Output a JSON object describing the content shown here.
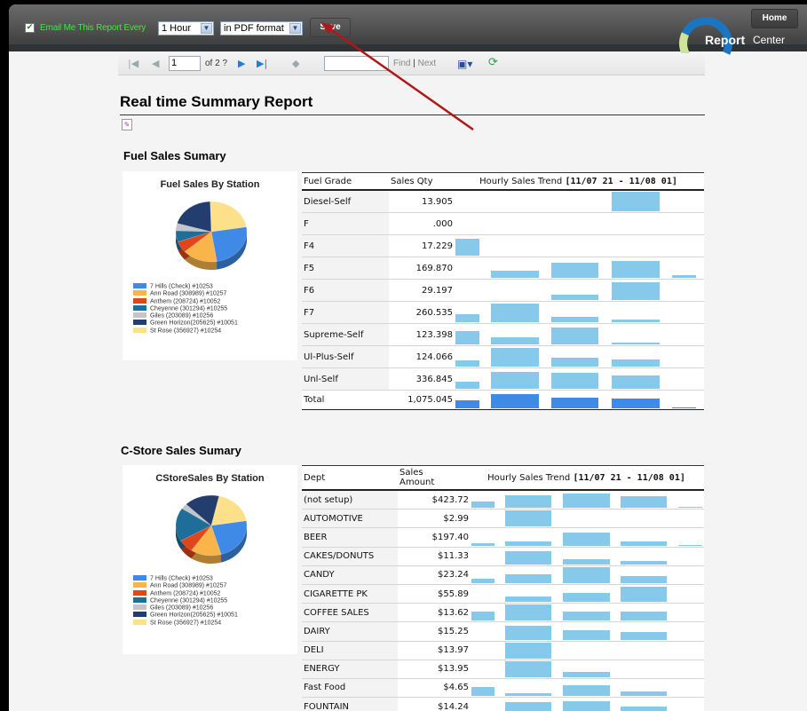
{
  "top_bar": {
    "email_checkbox_checked": true,
    "email_label": "Email Me This Report Every",
    "interval_select": "1 Hour",
    "format_select": "in PDF format",
    "save_label": "Save",
    "home_label": "Home",
    "logo_report": "Report",
    "logo_center": "Center",
    "accent_green": "#3ee83e"
  },
  "viewer_toolbar": {
    "page_value": "1",
    "page_of": "of 2 ?",
    "find_value": "",
    "find_label": "Find",
    "separator": "|",
    "next_label": "Next",
    "icons": [
      "first-page-icon",
      "previous-page-icon",
      "next-page-icon",
      "last-page-icon",
      "back-icon",
      "export-icon",
      "refresh-icon"
    ]
  },
  "report": {
    "title": "Real time Summary Report",
    "fuel": {
      "section_title": "Fuel Sales Sumary",
      "chart": {
        "title": "Fuel Sales By Station",
        "legend": [
          {
            "label": "7 Hills (Check) #10253",
            "color": "#3f8ae6"
          },
          {
            "label": "Ann Road (308989) #10257",
            "color": "#f9b44a"
          },
          {
            "label": "Anthem (208724) #10052",
            "color": "#e1461b"
          },
          {
            "label": "Cheyenne (301294) #10255",
            "color": "#1e6e99"
          },
          {
            "label": "Giles (203089) #10256",
            "color": "#c2c5c9"
          },
          {
            "label": "Green Horizon(205625) #10051",
            "color": "#233d6e"
          },
          {
            "label": "St Rose (356927) #10254",
            "color": "#fde08a"
          }
        ],
        "slices": [
          0.25,
          0.16,
          0.06,
          0.06,
          0.04,
          0.2,
          0.23
        ]
      },
      "table": {
        "headers": {
          "col1": "Fuel Grade",
          "col2": "Sales Qty",
          "col3": "Hourly Sales Trend",
          "range": "[11/07 21 - 11/08 01]"
        },
        "rows": [
          {
            "name": "Diesel-Self",
            "value": "13.905",
            "trend": [
              0,
              0,
              0,
              1.0,
              0
            ]
          },
          {
            "name": "F",
            "value": ".000",
            "trend": [
              0,
              0,
              0,
              0,
              0
            ]
          },
          {
            "name": "F4",
            "value": "17.229",
            "trend": [
              0.85,
              0,
              0,
              0,
              0
            ]
          },
          {
            "name": "F5",
            "value": "169.870",
            "trend": [
              0,
              0.35,
              0.75,
              0.85,
              0.15
            ]
          },
          {
            "name": "F6",
            "value": "29.197",
            "trend": [
              0,
              0,
              0.25,
              0.9,
              0
            ]
          },
          {
            "name": "F7",
            "value": "260.535",
            "trend": [
              0.4,
              0.95,
              0.25,
              0.15,
              0
            ]
          },
          {
            "name": "Supreme-Self",
            "value": "123.398",
            "trend": [
              0.7,
              0.35,
              0.85,
              0.1,
              0
            ]
          },
          {
            "name": "Ul-Plus-Self",
            "value": "124.066",
            "trend": [
              0.3,
              0.95,
              0.45,
              0.35,
              0
            ]
          },
          {
            "name": "Unl-Self",
            "value": "336.845",
            "trend": [
              0.35,
              0.85,
              0.8,
              0.7,
              0
            ]
          }
        ],
        "total": {
          "name": "Total",
          "value": "1,075.045",
          "trend": [
            0.45,
            0.85,
            0.65,
            0.6,
            0.06
          ]
        }
      }
    },
    "cstore": {
      "section_title": "C-Store Sales Sumary",
      "chart": {
        "title": "CStoreSales By Station",
        "legend": [
          {
            "label": "7 Hills (Check) #10253",
            "color": "#3f8ae6"
          },
          {
            "label": "Ann Road (308989) #10257",
            "color": "#f9b44a"
          },
          {
            "label": "Anthem (208724) #10052",
            "color": "#e1461b"
          },
          {
            "label": "Cheyenne (301294) #10255",
            "color": "#1e6e99"
          },
          {
            "label": "Giles (203089) #10256",
            "color": "#c2c5c9"
          },
          {
            "label": "Green Horizon(205625) #10051",
            "color": "#233d6e"
          },
          {
            "label": "St Rose (356927) #10254",
            "color": "#fde08a"
          }
        ],
        "slices": [
          0.23,
          0.14,
          0.07,
          0.18,
          0.03,
          0.16,
          0.19
        ]
      },
      "table": {
        "headers": {
          "col1": "Dept",
          "col2a": "Sales",
          "col2b": "Amount",
          "col3": "Hourly Sales Trend",
          "range": "[11/07 21 - 11/08 01]"
        },
        "rows": [
          {
            "name": "(not setup)",
            "value": "$423.72",
            "trend": [
              0.4,
              0.75,
              0.9,
              0.7,
              0.05
            ]
          },
          {
            "name": "AUTOMOTIVE",
            "value": "$2.99",
            "trend": [
              0,
              1.0,
              0,
              0,
              0
            ]
          },
          {
            "name": "BEER",
            "value": "$197.40",
            "trend": [
              0.15,
              0.25,
              0.85,
              0.3,
              0.05
            ]
          },
          {
            "name": "CAKES/DONUTS",
            "value": "$11.33",
            "trend": [
              0,
              0.85,
              0.35,
              0.2,
              0
            ]
          },
          {
            "name": "CANDY",
            "value": "$23.24",
            "trend": [
              0.3,
              0.55,
              1.0,
              0.45,
              0
            ]
          },
          {
            "name": "CIGARETTE PK",
            "value": "$55.89",
            "trend": [
              0,
              0.35,
              0.55,
              0.95,
              0
            ]
          },
          {
            "name": "COFFEE SALES",
            "value": "$13.62",
            "trend": [
              0.55,
              1.0,
              0.55,
              0.55,
              0
            ]
          },
          {
            "name": "DAIRY",
            "value": "$15.25",
            "trend": [
              0,
              0.9,
              0.6,
              0.5,
              0
            ]
          },
          {
            "name": "DELI",
            "value": "$13.97",
            "trend": [
              0,
              1.0,
              0,
              0,
              0
            ]
          },
          {
            "name": "ENERGY",
            "value": "$13.95",
            "trend": [
              0,
              1.0,
              0.35,
              0,
              0
            ]
          },
          {
            "name": "Fast Food",
            "value": "$4.65",
            "trend": [
              0.55,
              0.15,
              0.65,
              0.25,
              0
            ]
          },
          {
            "name": "FOUNTAIN",
            "value": "$14.24",
            "trend": [
              0.2,
              0.75,
              0.85,
              0.5,
              0
            ]
          }
        ]
      }
    }
  },
  "annotation": {
    "arrow_color": "#b01818",
    "points_to": "save-button"
  }
}
